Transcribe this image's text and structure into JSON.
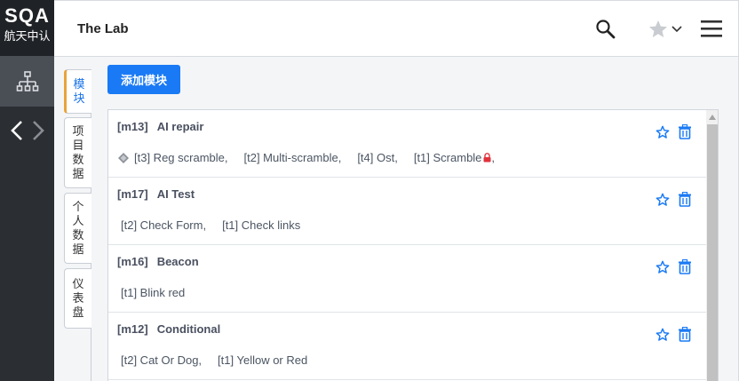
{
  "logo": {
    "line1": "SQA",
    "line2": "航天中认"
  },
  "header": {
    "title": "The Lab"
  },
  "icons": {
    "rail_modules": "sitemap-icon",
    "rail_back": "chevron-left-icon",
    "rail_forward": "chevron-right-icon",
    "search": "search-icon",
    "favorite": "star-icon",
    "favorite_menu": "chevron-down-icon",
    "menu": "hamburger-menu-icon",
    "module_fav": "star-outline-icon",
    "module_delete": "trash-icon",
    "task_diamond": "diamond-icon",
    "task_lock": "lock-icon"
  },
  "colors": {
    "accent": "#1a7af5",
    "rail": "#2b2e33",
    "active_tab_border": "#e8a33a",
    "lock": "#e0323c"
  },
  "tabs": [
    {
      "label": "模块",
      "active": true
    },
    {
      "label": "项目数据",
      "active": false
    },
    {
      "label": "个人数据",
      "active": false
    },
    {
      "label": "仪表盘",
      "active": false
    }
  ],
  "toolbar": {
    "add_module_label": "添加模块"
  },
  "modules": [
    {
      "code": "[m13]",
      "name": "AI repair",
      "tasks": [
        "[t3] Reg scramble,",
        "[t2] Multi-scramble,",
        "[t4] Ost,",
        "[t1] Scramble",
        ","
      ]
    },
    {
      "code": "[m17]",
      "name": "AI Test",
      "tasks": [
        "[t2] Check Form,",
        "[t1] Check links"
      ]
    },
    {
      "code": "[m16]",
      "name": "Beacon",
      "tasks": [
        "[t1] Blink red"
      ]
    },
    {
      "code": "[m12]",
      "name": "Conditional",
      "tasks": [
        "[t2] Cat Or Dog,",
        "[t1] Yellow or Red"
      ]
    }
  ]
}
